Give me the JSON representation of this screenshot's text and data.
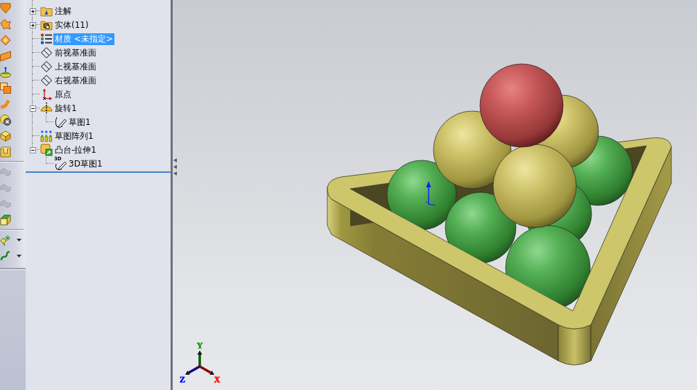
{
  "toolbar": {
    "groups": [
      {
        "items": [
          {
            "kind": "funnel",
            "disabled": false,
            "dropdown": false
          },
          {
            "kind": "twist",
            "disabled": false,
            "dropdown": false
          },
          {
            "kind": "diamond",
            "disabled": false,
            "dropdown": false
          },
          {
            "kind": "slab",
            "disabled": false,
            "dropdown": false
          },
          {
            "kind": "dome",
            "disabled": false,
            "dropdown": false
          },
          {
            "kind": "stack",
            "disabled": false,
            "dropdown": false
          },
          {
            "kind": "bend",
            "disabled": false,
            "dropdown": false
          },
          {
            "kind": "ball",
            "disabled": false,
            "dropdown": false
          },
          {
            "kind": "box",
            "disabled": false,
            "dropdown": false
          },
          {
            "kind": "bracket",
            "disabled": false,
            "dropdown": false
          }
        ]
      },
      {
        "items": [
          {
            "kind": "wave",
            "disabled": true,
            "dropdown": false
          },
          {
            "kind": "wave",
            "disabled": true,
            "dropdown": false
          },
          {
            "kind": "wave",
            "disabled": true,
            "dropdown": false
          },
          {
            "kind": "cube",
            "disabled": false,
            "dropdown": false
          }
        ]
      },
      {
        "items": [
          {
            "kind": "spark",
            "disabled": false,
            "dropdown": true
          },
          {
            "kind": "curve",
            "disabled": false,
            "dropdown": true
          }
        ]
      }
    ]
  },
  "tree": {
    "items": [
      {
        "label": "注解",
        "kind": "annotations",
        "selected": false,
        "expanded": false
      },
      {
        "label": "实体(11)",
        "kind": "solids",
        "selected": false,
        "expanded": false
      },
      {
        "label": "材质 <未指定>",
        "kind": "material",
        "selected": true
      },
      {
        "label": "前视基准面",
        "kind": "plane",
        "selected": false
      },
      {
        "label": "上视基准面",
        "kind": "plane",
        "selected": false
      },
      {
        "label": "右视基准面",
        "kind": "plane",
        "selected": false
      },
      {
        "label": "原点",
        "kind": "origin",
        "selected": false
      },
      {
        "label": "旋转1",
        "kind": "revolve",
        "selected": false,
        "expanded": true,
        "children": [
          {
            "label": "草图1",
            "kind": "sketch",
            "selected": false
          }
        ]
      },
      {
        "label": "草图阵列1",
        "kind": "pattern",
        "selected": false
      },
      {
        "label": "凸台-拉伸1",
        "kind": "extrude",
        "selected": false,
        "expanded": true,
        "children": [
          {
            "label": "3D草图1",
            "kind": "sketch3d",
            "selected": false,
            "icon_label": "3D"
          }
        ]
      }
    ]
  },
  "triad": {
    "axes": [
      {
        "label": "Y",
        "kind": "up",
        "color": "#00a000"
      },
      {
        "label": "Z",
        "kind": "down-left",
        "color": "#0000ff"
      },
      {
        "label": "X",
        "kind": "down-right",
        "color": "#ff0000"
      }
    ]
  }
}
